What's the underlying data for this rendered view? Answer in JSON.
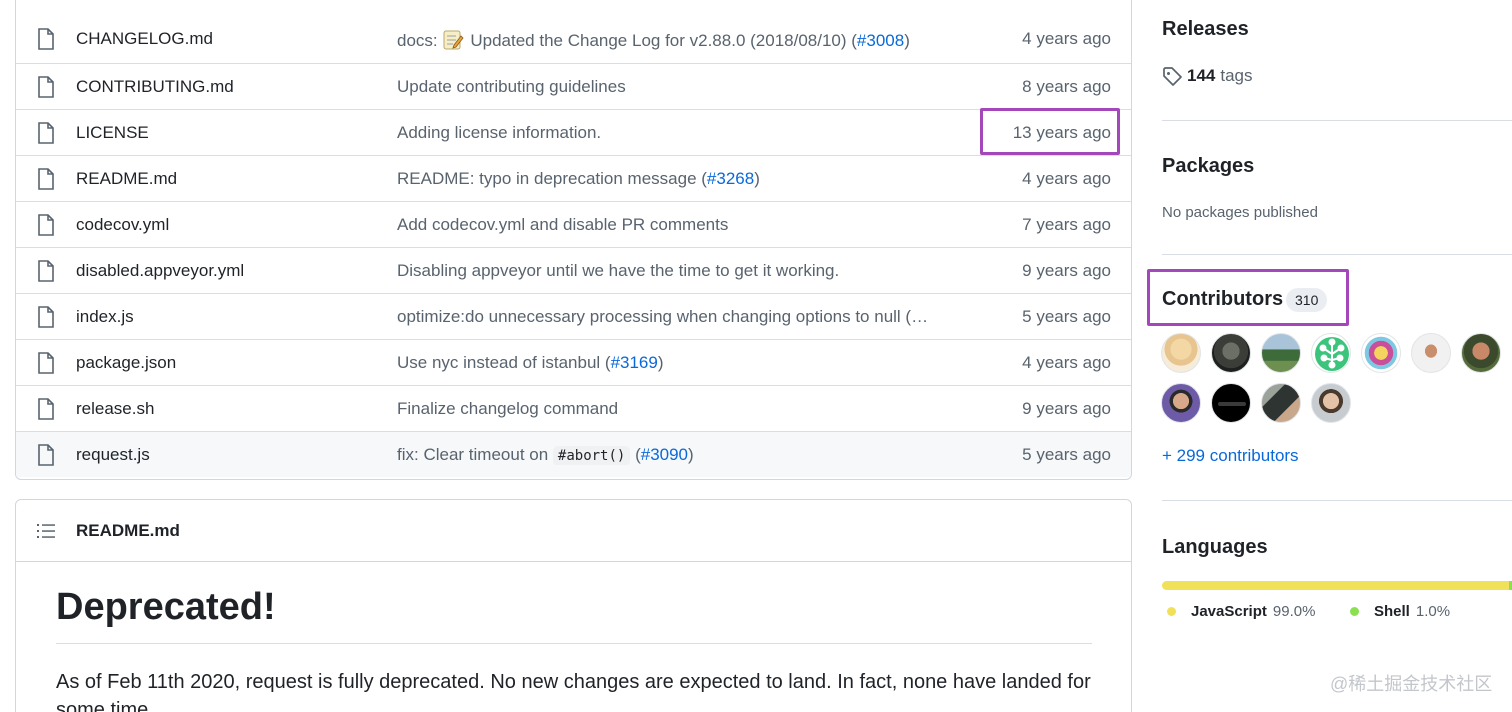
{
  "files": [
    {
      "name": "CHANGELOG.md",
      "msg_prefix": "docs: ",
      "msg": "Updated the Change Log for v2.88.0 (2018/08/10) (",
      "link": "#3008",
      "msg_suffix": ")",
      "time": "4 years ago"
    },
    {
      "name": "CONTRIBUTING.md",
      "msg": "Update contributing guidelines",
      "time": "8 years ago"
    },
    {
      "name": "LICENSE",
      "msg": "Adding license information.",
      "time": "13 years ago"
    },
    {
      "name": "README.md",
      "msg": "README: typo in deprecation message (",
      "link": "#3268",
      "msg_suffix": ")",
      "time": "4 years ago"
    },
    {
      "name": "codecov.yml",
      "msg": "Add codecov.yml and disable PR comments",
      "time": "7 years ago"
    },
    {
      "name": "disabled.appveyor.yml",
      "msg": "Disabling appveyor until we have the time to get it working.",
      "time": "9 years ago"
    },
    {
      "name": "index.js",
      "msg": "optimize:do unnecessary processing when changing options to null (…",
      "time": "5 years ago"
    },
    {
      "name": "package.json",
      "msg": "Use nyc instead of istanbul (",
      "link": "#3169",
      "msg_suffix": ")",
      "time": "4 years ago"
    },
    {
      "name": "release.sh",
      "msg": "Finalize changelog command",
      "time": "9 years ago"
    },
    {
      "name": "request.js",
      "msg": "fix: Clear timeout on ",
      "code": "#abort()",
      "msg_mid": " (",
      "link": "#3090",
      "msg_suffix": ")",
      "time": "5 years ago"
    }
  ],
  "readme": {
    "file": "README.md",
    "heading": "Deprecated!",
    "paragraph": "As of Feb 11th 2020, request is fully deprecated. No new changes are expected to land. In fact, none have landed for some time."
  },
  "sidebar": {
    "releases_title": "Releases",
    "tags_count": "144",
    "tags_label": "tags",
    "packages_title": "Packages",
    "packages_empty": "No packages published",
    "contributors_title": "Contributors",
    "contributors_count": "310",
    "more_contributors": "+ 299 contributors",
    "languages_title": "Languages",
    "languages": [
      {
        "name": "JavaScript",
        "pct": "99.0%",
        "percent": 99.0,
        "color": "#f1e05a"
      },
      {
        "name": "Shell",
        "pct": "1.0%",
        "percent": 1.0,
        "color": "#89e051"
      }
    ]
  },
  "watermark": "@稀土掘金技术社区",
  "colors": {
    "accent": "#0969da",
    "highlight": "#a347ba"
  }
}
